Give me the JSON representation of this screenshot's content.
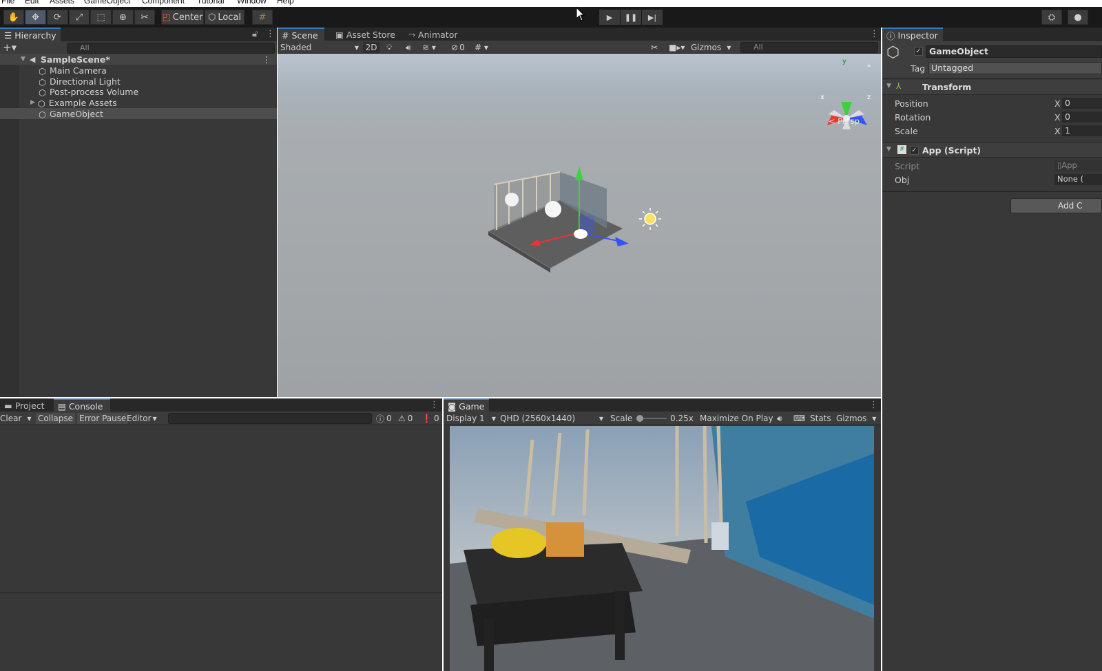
{
  "menu": [
    "File",
    "Edit",
    "Assets",
    "GameObject",
    "Component",
    "Tutorial",
    "Window",
    "Help"
  ],
  "toolbar": {
    "pivot_label": "Center",
    "space_label": "Local"
  },
  "hierarchy": {
    "tab_label": "Hierarchy",
    "search_placeholder": "All",
    "scene_name": "SampleScene*",
    "items": [
      "Main Camera",
      "Directional Light",
      "Post-process Volume",
      "Example Assets",
      "GameObject"
    ]
  },
  "scene": {
    "tabs": [
      "Scene",
      "Asset Store",
      "Animator"
    ],
    "shading_mode": "Shaded",
    "mode_2d": "2D",
    "hidden_count": "0",
    "gizmos_label": "Gizmos",
    "search_placeholder": "All",
    "projection_label": "< Persp",
    "axis_labels": [
      "y",
      "x",
      "z"
    ]
  },
  "inspector": {
    "tab_label": "Inspector",
    "object_name": "GameObject",
    "tag_label": "Tag",
    "tag_value": "Untagged",
    "transform": {
      "title": "Transform",
      "rows": [
        {
          "label": "Position",
          "axis": "X",
          "value": "0"
        },
        {
          "label": "Rotation",
          "axis": "X",
          "value": "0"
        },
        {
          "label": "Scale",
          "axis": "X",
          "value": "1"
        }
      ]
    },
    "script_component": {
      "title": "App (Script)",
      "script_label": "Script",
      "script_value": "App",
      "obj_label": "Obj",
      "obj_value": "None ("
    },
    "add_component_label": "Add C"
  },
  "console": {
    "tabs": [
      "Project",
      "Console"
    ],
    "clear_label": "Clear",
    "collapse_label": "Collapse",
    "error_pause_label": "Error Pause",
    "editor_label": "Editor",
    "log_count": "0",
    "warning_count": "0",
    "error_count": "0"
  },
  "game": {
    "tab_label": "Game",
    "display": "Display 1",
    "resolution": "QHD (2560x1440)",
    "scale_label": "Scale",
    "scale_value": "0.25x",
    "maximize_label": "Maximize On Play",
    "stats_label": "Stats",
    "gizmos_label": "Gizmos"
  },
  "colors": {
    "accent": "#3a79bb",
    "panel": "#383838",
    "dark": "#191919",
    "tabbar": "#282828",
    "selection": "#4d4d4d"
  }
}
